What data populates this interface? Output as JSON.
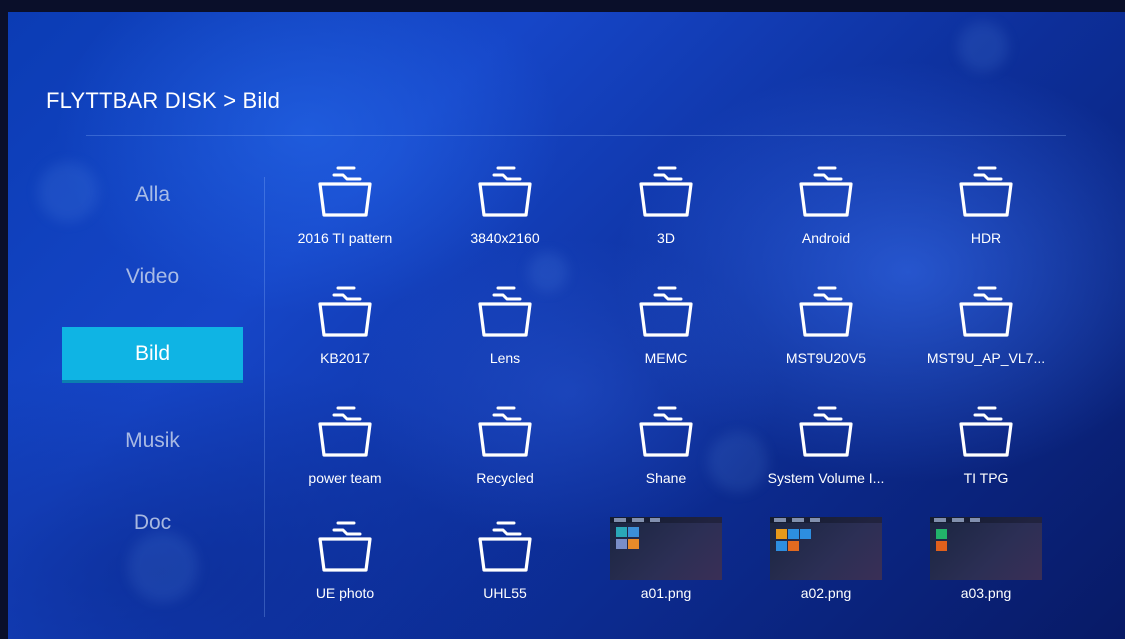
{
  "header": {
    "breadcrumb": "FLYTTBAR DISK > Bild"
  },
  "sidebar": {
    "items": [
      {
        "label": "Alla",
        "active": false
      },
      {
        "label": "Video",
        "active": false
      },
      {
        "label": "Bild",
        "active": true
      },
      {
        "label": "Musik",
        "active": false
      },
      {
        "label": "Doc",
        "active": false
      }
    ]
  },
  "files": [
    {
      "name": "2016 TI pattern",
      "type": "folder"
    },
    {
      "name": "3840x2160",
      "type": "folder"
    },
    {
      "name": "3D",
      "type": "folder"
    },
    {
      "name": "Android",
      "type": "folder"
    },
    {
      "name": "HDR",
      "type": "folder"
    },
    {
      "name": "KB2017",
      "type": "folder"
    },
    {
      "name": "Lens",
      "type": "folder"
    },
    {
      "name": "MEMC",
      "type": "folder"
    },
    {
      "name": "MST9U20V5",
      "type": "folder"
    },
    {
      "name": "MST9U_AP_VL7...",
      "type": "folder"
    },
    {
      "name": "power team",
      "type": "folder"
    },
    {
      "name": "Recycled",
      "type": "folder"
    },
    {
      "name": "Shane",
      "type": "folder"
    },
    {
      "name": "System Volume I...",
      "type": "folder"
    },
    {
      "name": "TI TPG",
      "type": "folder"
    },
    {
      "name": "UE photo",
      "type": "folder"
    },
    {
      "name": "UHL55",
      "type": "folder"
    },
    {
      "name": "a01.png",
      "type": "image"
    },
    {
      "name": "a02.png",
      "type": "image"
    },
    {
      "name": "a03.png",
      "type": "image"
    }
  ],
  "colors": {
    "accent": "#0fb4e4",
    "background": "#1646c8"
  }
}
